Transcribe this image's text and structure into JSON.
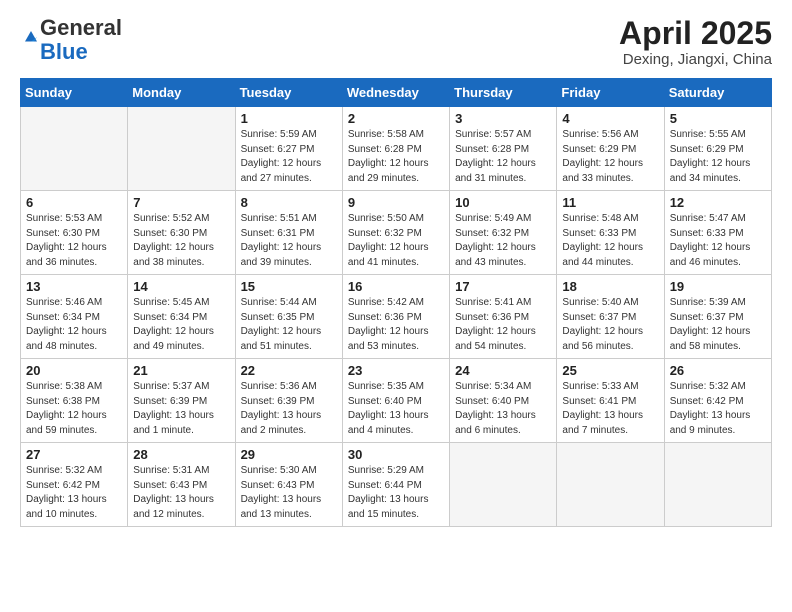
{
  "logo": {
    "general": "General",
    "blue": "Blue"
  },
  "title": {
    "month": "April 2025",
    "location": "Dexing, Jiangxi, China"
  },
  "days_header": [
    "Sunday",
    "Monday",
    "Tuesday",
    "Wednesday",
    "Thursday",
    "Friday",
    "Saturday"
  ],
  "weeks": [
    [
      {
        "day": "",
        "empty": true
      },
      {
        "day": "",
        "empty": true
      },
      {
        "day": "1",
        "sunrise": "5:59 AM",
        "sunset": "6:27 PM",
        "daylight": "12 hours and 27 minutes."
      },
      {
        "day": "2",
        "sunrise": "5:58 AM",
        "sunset": "6:28 PM",
        "daylight": "12 hours and 29 minutes."
      },
      {
        "day": "3",
        "sunrise": "5:57 AM",
        "sunset": "6:28 PM",
        "daylight": "12 hours and 31 minutes."
      },
      {
        "day": "4",
        "sunrise": "5:56 AM",
        "sunset": "6:29 PM",
        "daylight": "12 hours and 33 minutes."
      },
      {
        "day": "5",
        "sunrise": "5:55 AM",
        "sunset": "6:29 PM",
        "daylight": "12 hours and 34 minutes."
      }
    ],
    [
      {
        "day": "6",
        "sunrise": "5:53 AM",
        "sunset": "6:30 PM",
        "daylight": "12 hours and 36 minutes."
      },
      {
        "day": "7",
        "sunrise": "5:52 AM",
        "sunset": "6:30 PM",
        "daylight": "12 hours and 38 minutes."
      },
      {
        "day": "8",
        "sunrise": "5:51 AM",
        "sunset": "6:31 PM",
        "daylight": "12 hours and 39 minutes."
      },
      {
        "day": "9",
        "sunrise": "5:50 AM",
        "sunset": "6:32 PM",
        "daylight": "12 hours and 41 minutes."
      },
      {
        "day": "10",
        "sunrise": "5:49 AM",
        "sunset": "6:32 PM",
        "daylight": "12 hours and 43 minutes."
      },
      {
        "day": "11",
        "sunrise": "5:48 AM",
        "sunset": "6:33 PM",
        "daylight": "12 hours and 44 minutes."
      },
      {
        "day": "12",
        "sunrise": "5:47 AM",
        "sunset": "6:33 PM",
        "daylight": "12 hours and 46 minutes."
      }
    ],
    [
      {
        "day": "13",
        "sunrise": "5:46 AM",
        "sunset": "6:34 PM",
        "daylight": "12 hours and 48 minutes."
      },
      {
        "day": "14",
        "sunrise": "5:45 AM",
        "sunset": "6:34 PM",
        "daylight": "12 hours and 49 minutes."
      },
      {
        "day": "15",
        "sunrise": "5:44 AM",
        "sunset": "6:35 PM",
        "daylight": "12 hours and 51 minutes."
      },
      {
        "day": "16",
        "sunrise": "5:42 AM",
        "sunset": "6:36 PM",
        "daylight": "12 hours and 53 minutes."
      },
      {
        "day": "17",
        "sunrise": "5:41 AM",
        "sunset": "6:36 PM",
        "daylight": "12 hours and 54 minutes."
      },
      {
        "day": "18",
        "sunrise": "5:40 AM",
        "sunset": "6:37 PM",
        "daylight": "12 hours and 56 minutes."
      },
      {
        "day": "19",
        "sunrise": "5:39 AM",
        "sunset": "6:37 PM",
        "daylight": "12 hours and 58 minutes."
      }
    ],
    [
      {
        "day": "20",
        "sunrise": "5:38 AM",
        "sunset": "6:38 PM",
        "daylight": "12 hours and 59 minutes."
      },
      {
        "day": "21",
        "sunrise": "5:37 AM",
        "sunset": "6:39 PM",
        "daylight": "13 hours and 1 minute."
      },
      {
        "day": "22",
        "sunrise": "5:36 AM",
        "sunset": "6:39 PM",
        "daylight": "13 hours and 2 minutes."
      },
      {
        "day": "23",
        "sunrise": "5:35 AM",
        "sunset": "6:40 PM",
        "daylight": "13 hours and 4 minutes."
      },
      {
        "day": "24",
        "sunrise": "5:34 AM",
        "sunset": "6:40 PM",
        "daylight": "13 hours and 6 minutes."
      },
      {
        "day": "25",
        "sunrise": "5:33 AM",
        "sunset": "6:41 PM",
        "daylight": "13 hours and 7 minutes."
      },
      {
        "day": "26",
        "sunrise": "5:32 AM",
        "sunset": "6:42 PM",
        "daylight": "13 hours and 9 minutes."
      }
    ],
    [
      {
        "day": "27",
        "sunrise": "5:32 AM",
        "sunset": "6:42 PM",
        "daylight": "13 hours and 10 minutes."
      },
      {
        "day": "28",
        "sunrise": "5:31 AM",
        "sunset": "6:43 PM",
        "daylight": "13 hours and 12 minutes."
      },
      {
        "day": "29",
        "sunrise": "5:30 AM",
        "sunset": "6:43 PM",
        "daylight": "13 hours and 13 minutes."
      },
      {
        "day": "30",
        "sunrise": "5:29 AM",
        "sunset": "6:44 PM",
        "daylight": "13 hours and 15 minutes."
      },
      {
        "day": "",
        "empty": true
      },
      {
        "day": "",
        "empty": true
      },
      {
        "day": "",
        "empty": true
      }
    ]
  ],
  "labels": {
    "sunrise": "Sunrise: ",
    "sunset": "Sunset: ",
    "daylight": "Daylight: "
  }
}
